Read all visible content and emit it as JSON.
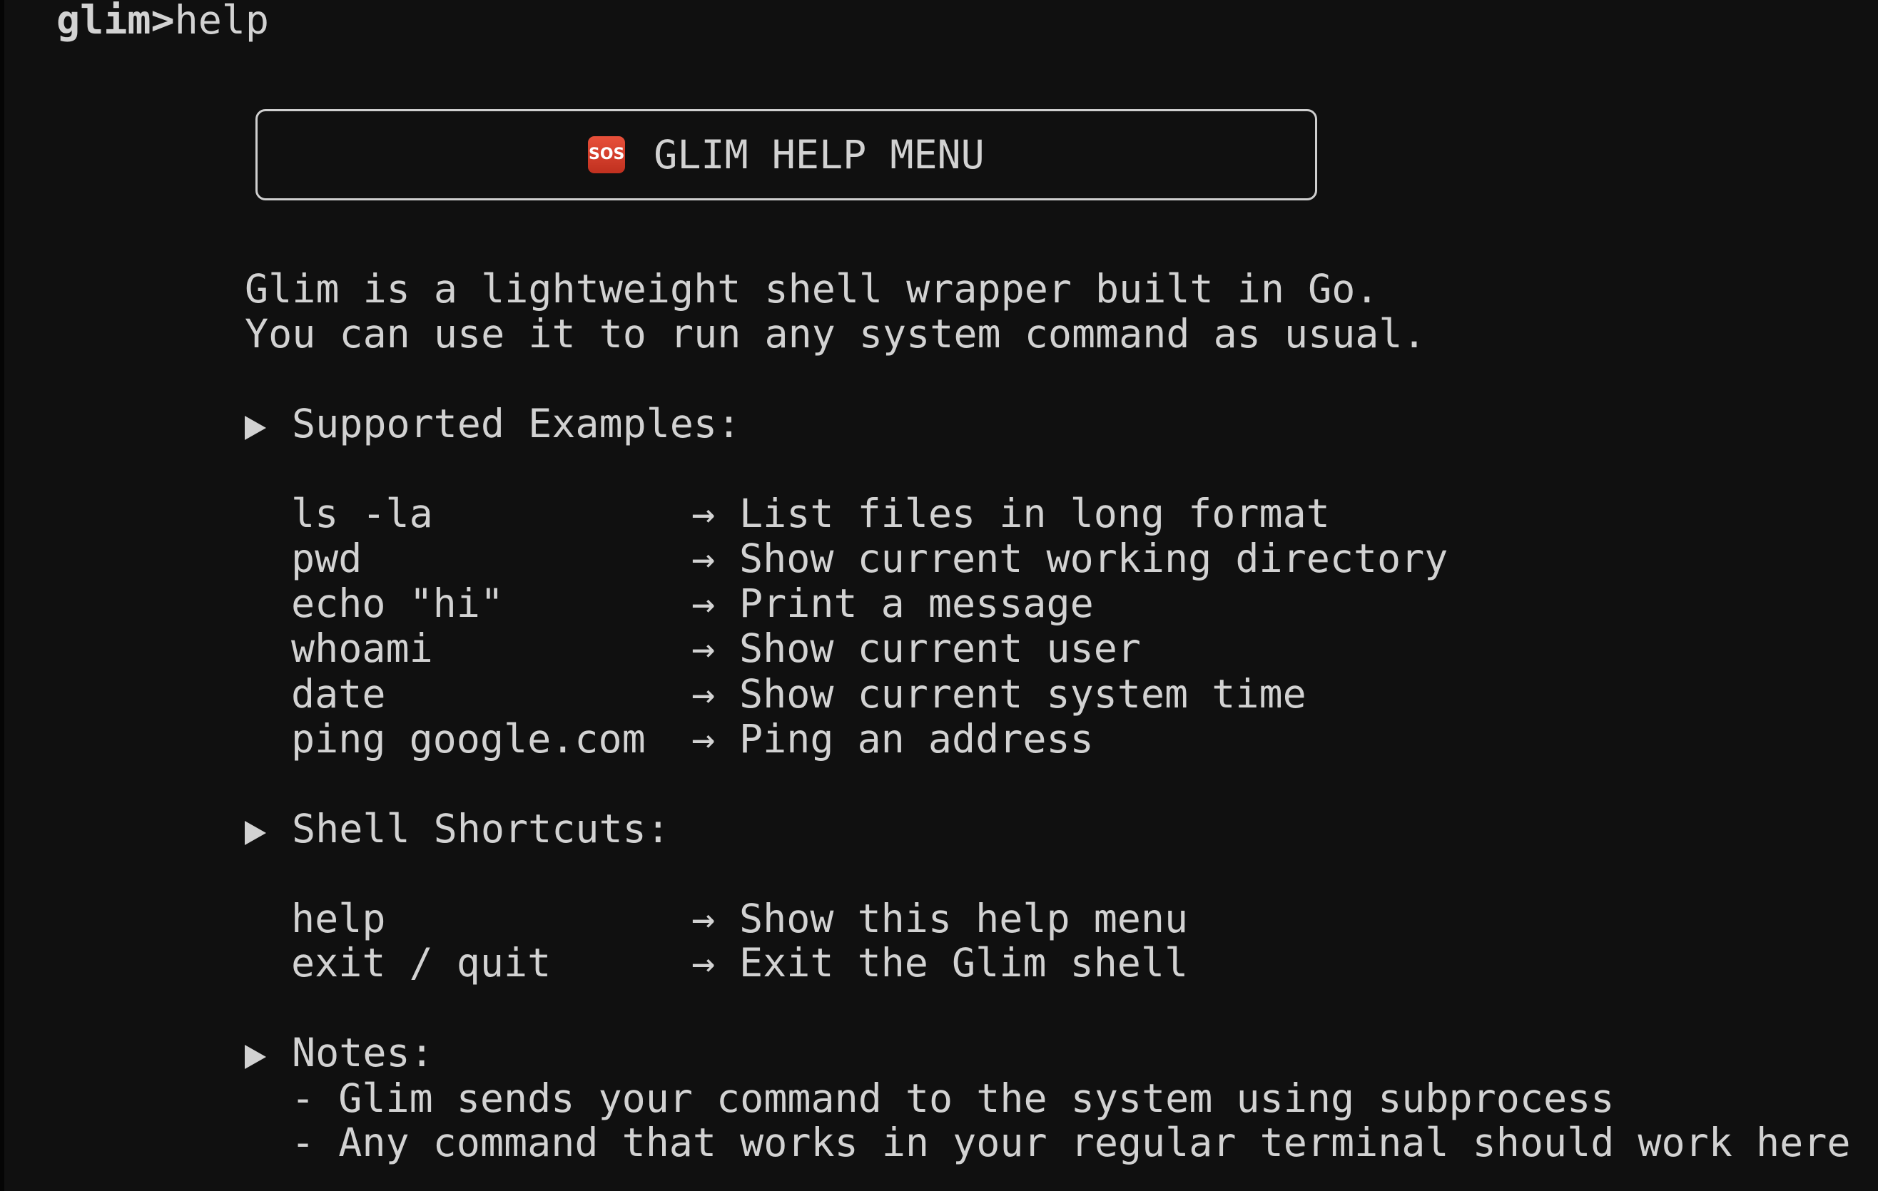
{
  "prompt": {
    "name": "glim>",
    "command": "help"
  },
  "header": {
    "icon": "sos-icon",
    "title": "GLIM HELP MENU"
  },
  "intro": [
    "Glim is a lightweight shell wrapper built in Go.",
    "You can use it to run any system command as usual."
  ],
  "examples": {
    "heading": "Supported Examples:",
    "rows": [
      {
        "cmd": "ls -la",
        "arrow": "→",
        "desc": "List files in long format"
      },
      {
        "cmd": "pwd",
        "arrow": "→",
        "desc": "Show current working directory"
      },
      {
        "cmd": "echo \"hi\"",
        "arrow": "→",
        "desc": "Print a message"
      },
      {
        "cmd": "whoami",
        "arrow": "→",
        "desc": "Show current user"
      },
      {
        "cmd": "date",
        "arrow": "→",
        "desc": "Show current system time"
      },
      {
        "cmd": "ping google.com",
        "arrow": "→",
        "desc": "Ping an address"
      }
    ]
  },
  "shortcuts": {
    "heading": "Shell Shortcuts:",
    "rows": [
      {
        "cmd": "help",
        "arrow": "→",
        "desc": "Show this help menu"
      },
      {
        "cmd": "exit / quit",
        "arrow": "→",
        "desc": "Exit the Glim shell"
      }
    ]
  },
  "notes": {
    "heading": "Notes:",
    "items": [
      "- Glim sends your command to the system using subprocess",
      "- Any command that works in your regular terminal should work here"
    ]
  },
  "colors": {
    "background": "#101010",
    "text": "#d2d2d2",
    "sos": "#d8402b"
  }
}
